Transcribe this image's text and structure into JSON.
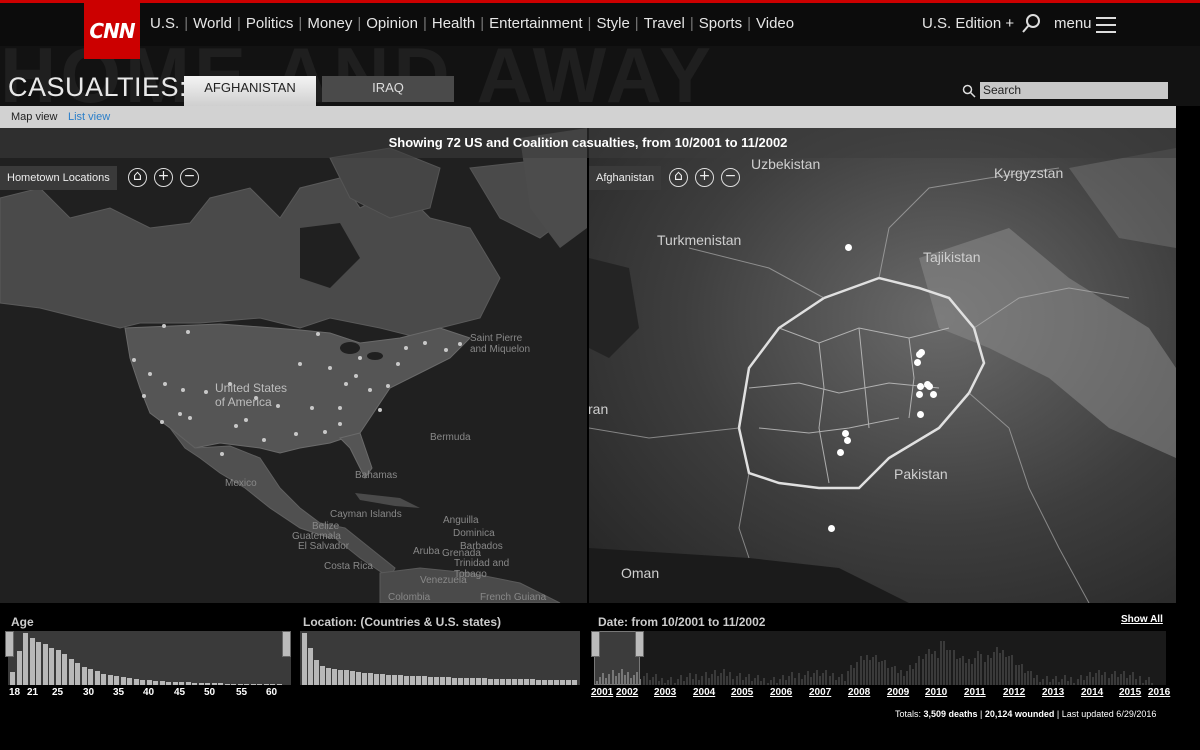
{
  "nav": {
    "logo": "CNN",
    "links": [
      "U.S.",
      "World",
      "Politics",
      "Money",
      "Opinion",
      "Health",
      "Entertainment",
      "Style",
      "Travel",
      "Sports",
      "Video"
    ],
    "edition": "U.S. Edition +",
    "menu": "menu"
  },
  "header": {
    "background_title": "HOME AND AWAY",
    "title": "CASUALTIES:",
    "tabs": [
      {
        "label": "AFGHANISTAN",
        "active": true
      },
      {
        "label": "IRAQ",
        "active": false
      }
    ],
    "search_placeholder": "Search"
  },
  "viewbar": {
    "map_view": "Map view",
    "list_view": "List view"
  },
  "showing": "Showing 72 US and Coalition casualties, from 10/2001 to 11/2002",
  "left_map": {
    "label": "Hometown Locations",
    "places": [
      "United States of America",
      "Mexico",
      "Saint Pierre and Miquelon",
      "Bermuda",
      "Bahamas",
      "Cayman Islands",
      "Belize",
      "Guatemala",
      "El Salvador",
      "Costa Rica",
      "Anguilla",
      "Dominica",
      "Barbados",
      "Aruba",
      "Grenada",
      "Trinidad and Tobago",
      "Venezuela",
      "Colombia",
      "French Guiana"
    ]
  },
  "right_map": {
    "label": "Afghanistan",
    "places": [
      "Uzbekistan",
      "Kyrgyzstan",
      "Turkmenistan",
      "Tajikistan",
      "Iran",
      "Pakistan",
      "Oman"
    ]
  },
  "filters": {
    "age_title": "Age",
    "age_ticks": [
      "18",
      "21",
      "25",
      "30",
      "35",
      "40",
      "45",
      "50",
      "55",
      "60"
    ],
    "location_title": "Location: (Countries & U.S. states)",
    "date_title": "Date: from 10/2001 to 11/2002",
    "show_all": "Show All",
    "year_ticks": [
      "2001",
      "2002",
      "2003",
      "2004",
      "2005",
      "2006",
      "2007",
      "2008",
      "2009",
      "2010",
      "2011",
      "2012",
      "2013",
      "2014",
      "2015",
      "2016"
    ]
  },
  "totals": {
    "prefix": "Totals: ",
    "deaths": "3,509 deaths",
    "wounded": "20,124 wounded",
    "updated": "Last updated 6/29/2016"
  },
  "colors": {
    "brand_red": "#cc0000",
    "link_blue": "#2a7ec9",
    "marker": "#ffffff"
  }
}
